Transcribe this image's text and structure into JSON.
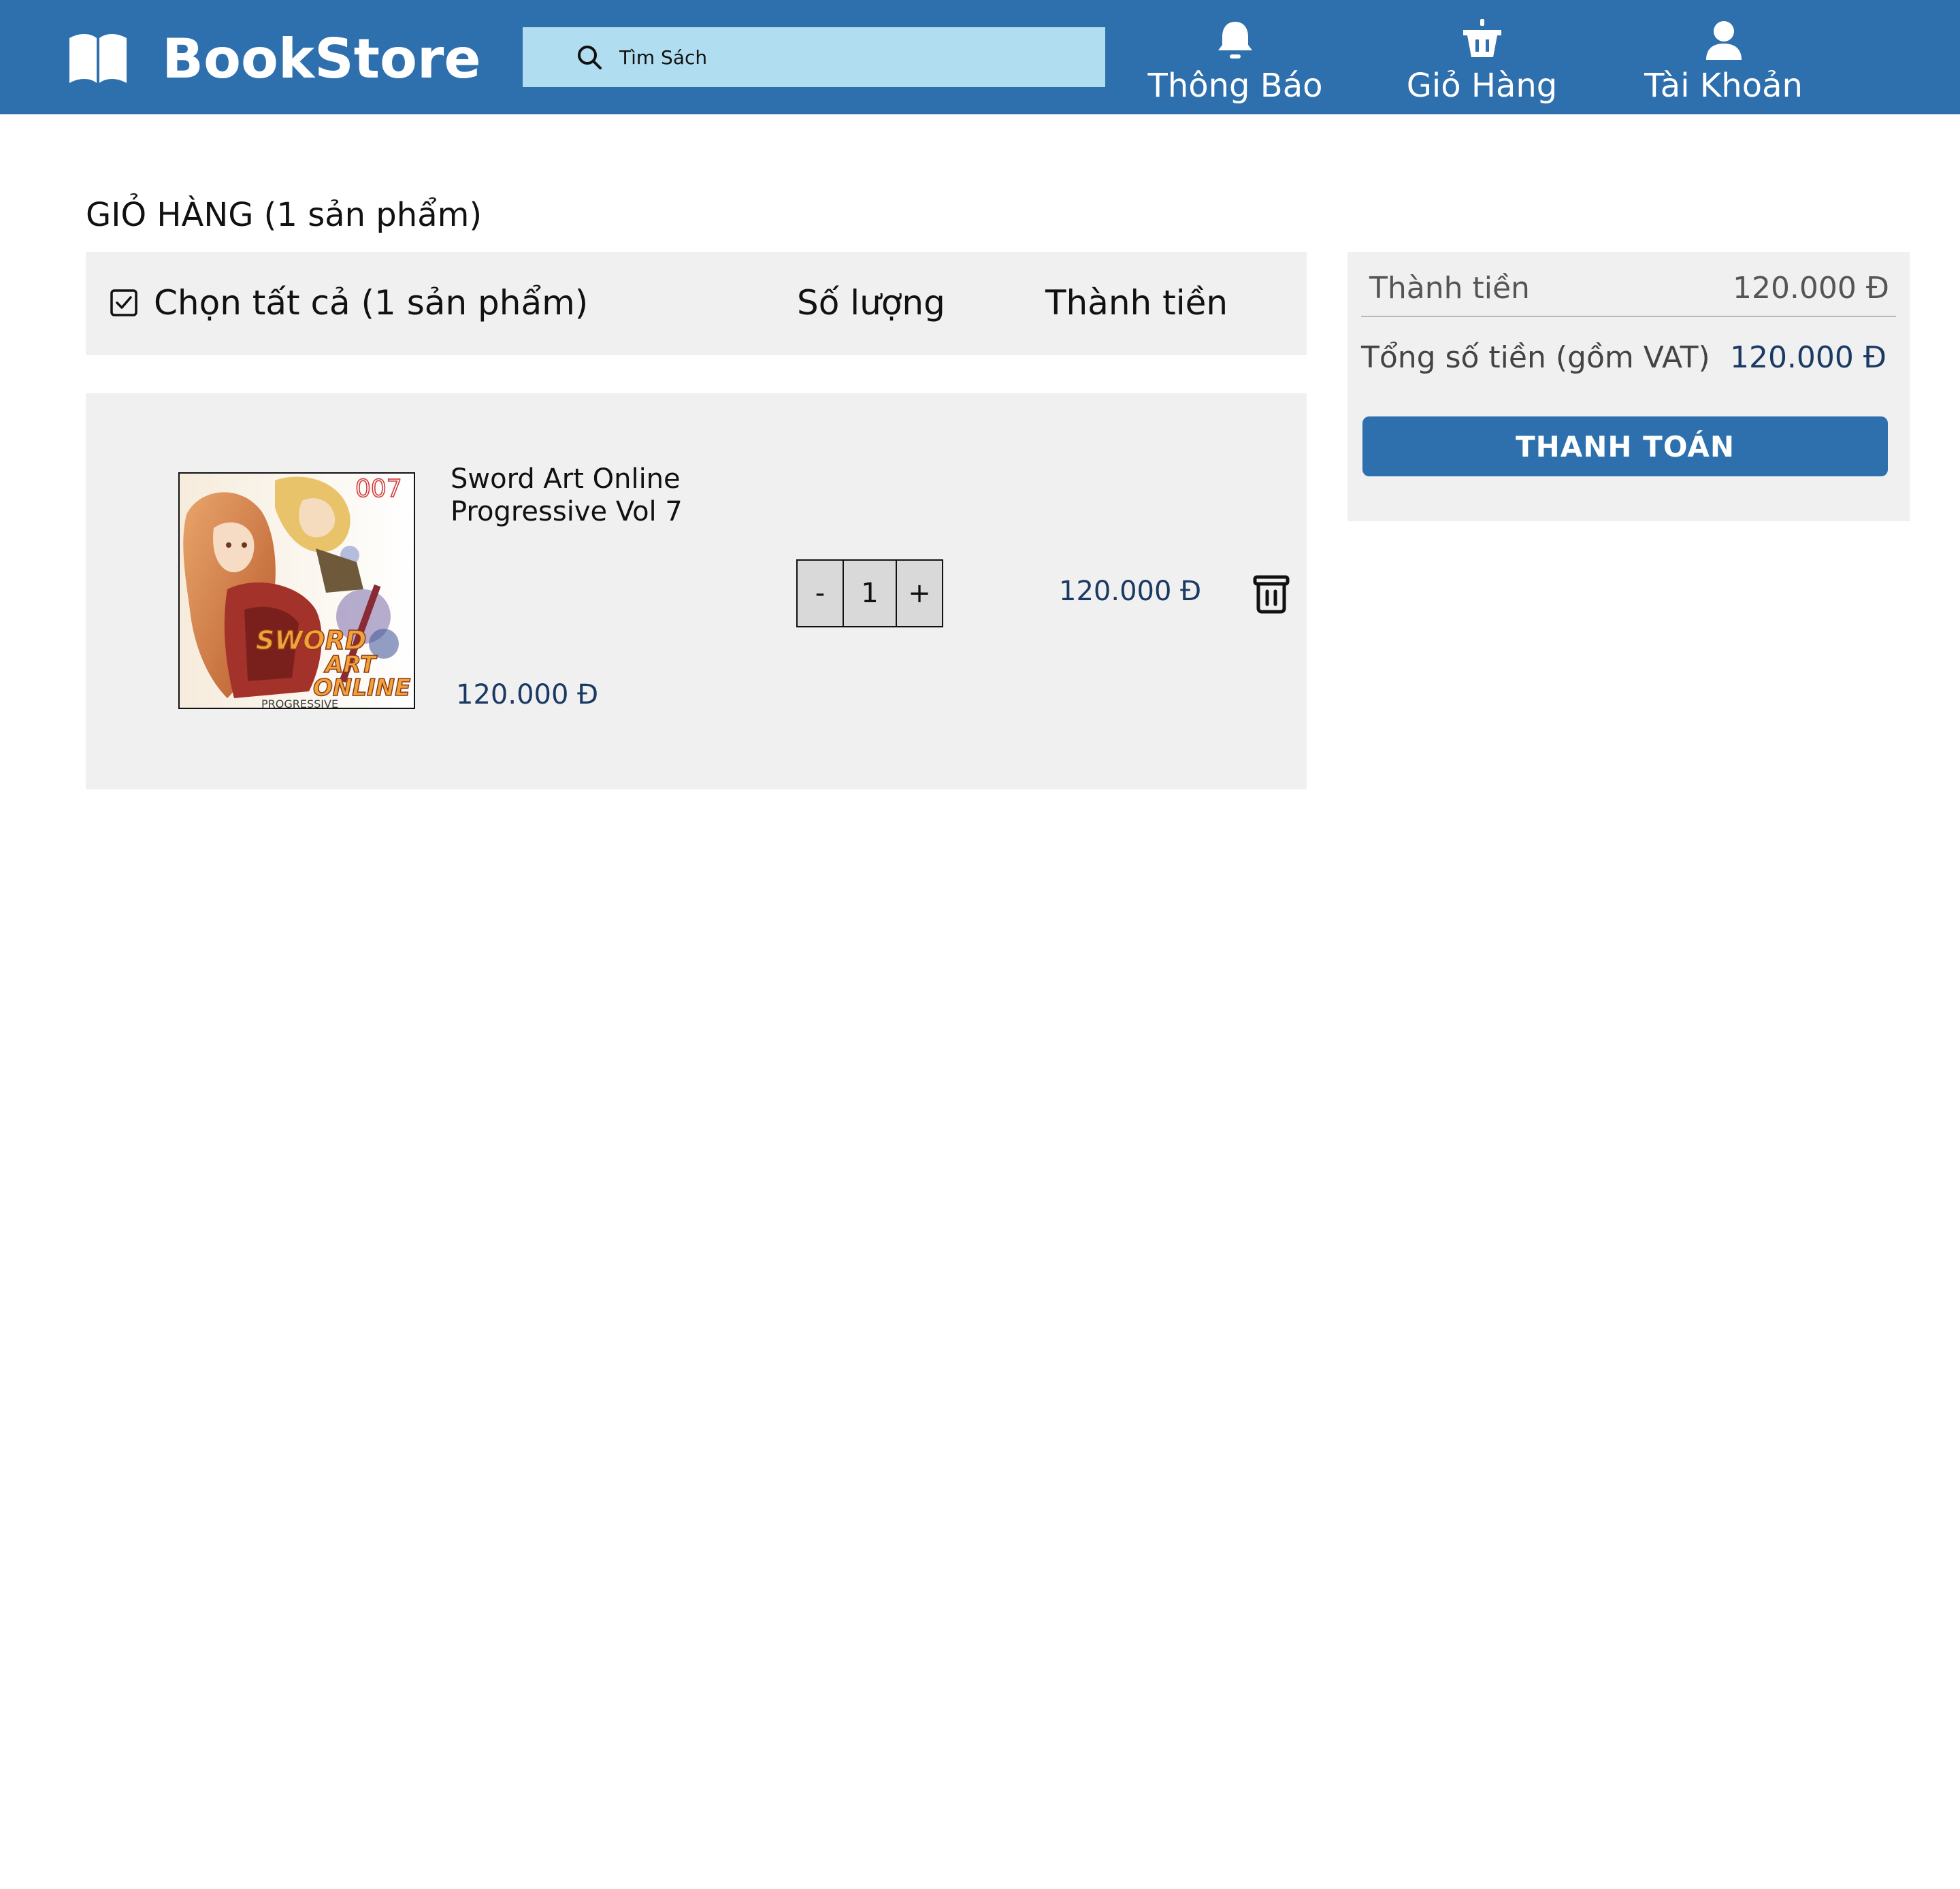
{
  "header": {
    "brand_name": "BookStore",
    "brand_icon": "open-book-icon",
    "search": {
      "placeholder": "Tìm Sách",
      "icon": "search-icon"
    },
    "nav": [
      {
        "label": "Thông Báo",
        "icon": "bell-icon"
      },
      {
        "label": "Giỏ Hàng",
        "icon": "basket-icon"
      },
      {
        "label": "Tài Khoản",
        "icon": "user-icon"
      }
    ]
  },
  "cart": {
    "title": "GIỎ HÀNG (1 sản phẩm)",
    "table_header": {
      "select_all_label": "Chọn tất cả (1 sản phẩm)",
      "select_all_checked": true,
      "quantity_label": "Số lượng",
      "total_label": "Thành tiền"
    },
    "items": [
      {
        "title": "Sword Art Online Progressive Vol 7",
        "price": "120.000 Đ",
        "quantity": "1",
        "decrement_label": "-",
        "increment_label": "+",
        "line_total": "120.000 Đ",
        "cover_text": {
          "volume": "007",
          "logo_line1": "SWORD",
          "logo_line2": "ART",
          "logo_line3": "ONLINE",
          "subtitle": "PROGRESSIVE"
        }
      }
    ]
  },
  "summary": {
    "subtotal_label": "Thành tiền",
    "subtotal_value": "120.000 Đ",
    "total_label": "Tổng số tiền (gồm VAT)",
    "total_value": "120.000 Đ",
    "checkout_label": "THANH TOÁN"
  },
  "colors": {
    "header_bg": "#2e6fad",
    "search_bg": "#b0ddef",
    "panel_bg": "#f0f0f0",
    "price_text": "#1b3a63",
    "checkout_bg": "#2e6fad"
  }
}
